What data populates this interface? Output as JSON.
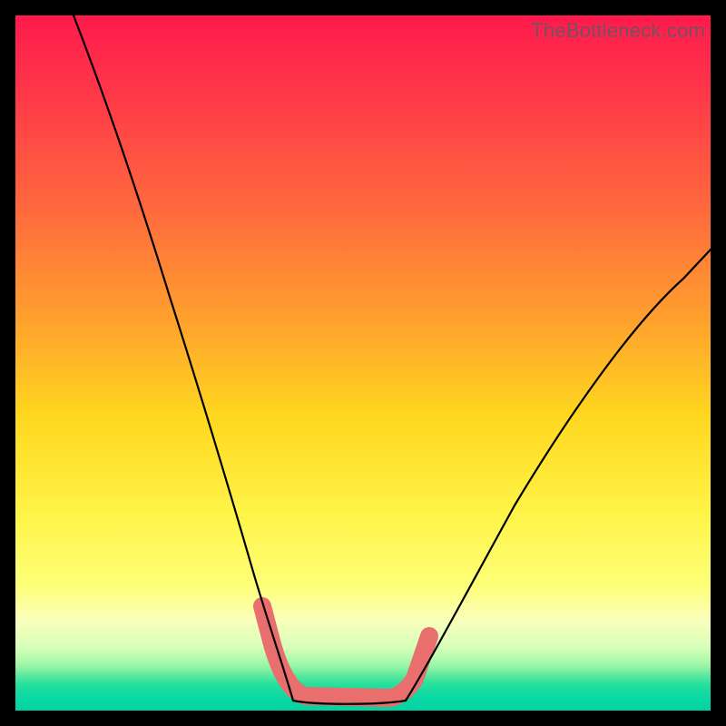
{
  "watermark": "TheBottleneck.com",
  "colors": {
    "curve": "#000000",
    "band": "#e96f6f",
    "frame": "#000000"
  },
  "chart_data": {
    "type": "line",
    "title": "",
    "xlabel": "",
    "ylabel": "",
    "xlim": [
      0,
      100
    ],
    "ylim": [
      0,
      100
    ],
    "series": [
      {
        "name": "left-curve",
        "x_norm": [
          0.083,
          0.13,
          0.18,
          0.24,
          0.3,
          0.345,
          0.375,
          0.4
        ],
        "y_norm": [
          0.0,
          0.12,
          0.26,
          0.44,
          0.64,
          0.81,
          0.92,
          0.985
        ]
      },
      {
        "name": "floor",
        "x_norm": [
          0.4,
          0.56
        ],
        "y_norm": [
          0.985,
          0.985
        ]
      },
      {
        "name": "right-curve",
        "x_norm": [
          0.56,
          0.6,
          0.68,
          0.78,
          0.88,
          0.96,
          1.0
        ],
        "y_norm": [
          0.985,
          0.92,
          0.79,
          0.62,
          0.48,
          0.38,
          0.335
        ]
      }
    ],
    "band": {
      "name": "highlight-band",
      "x_norm": [
        0.355,
        0.37,
        0.4,
        0.47,
        0.54,
        0.565,
        0.595
      ],
      "y_norm": [
        0.85,
        0.905,
        0.97,
        0.977,
        0.977,
        0.96,
        0.895
      ]
    }
  }
}
